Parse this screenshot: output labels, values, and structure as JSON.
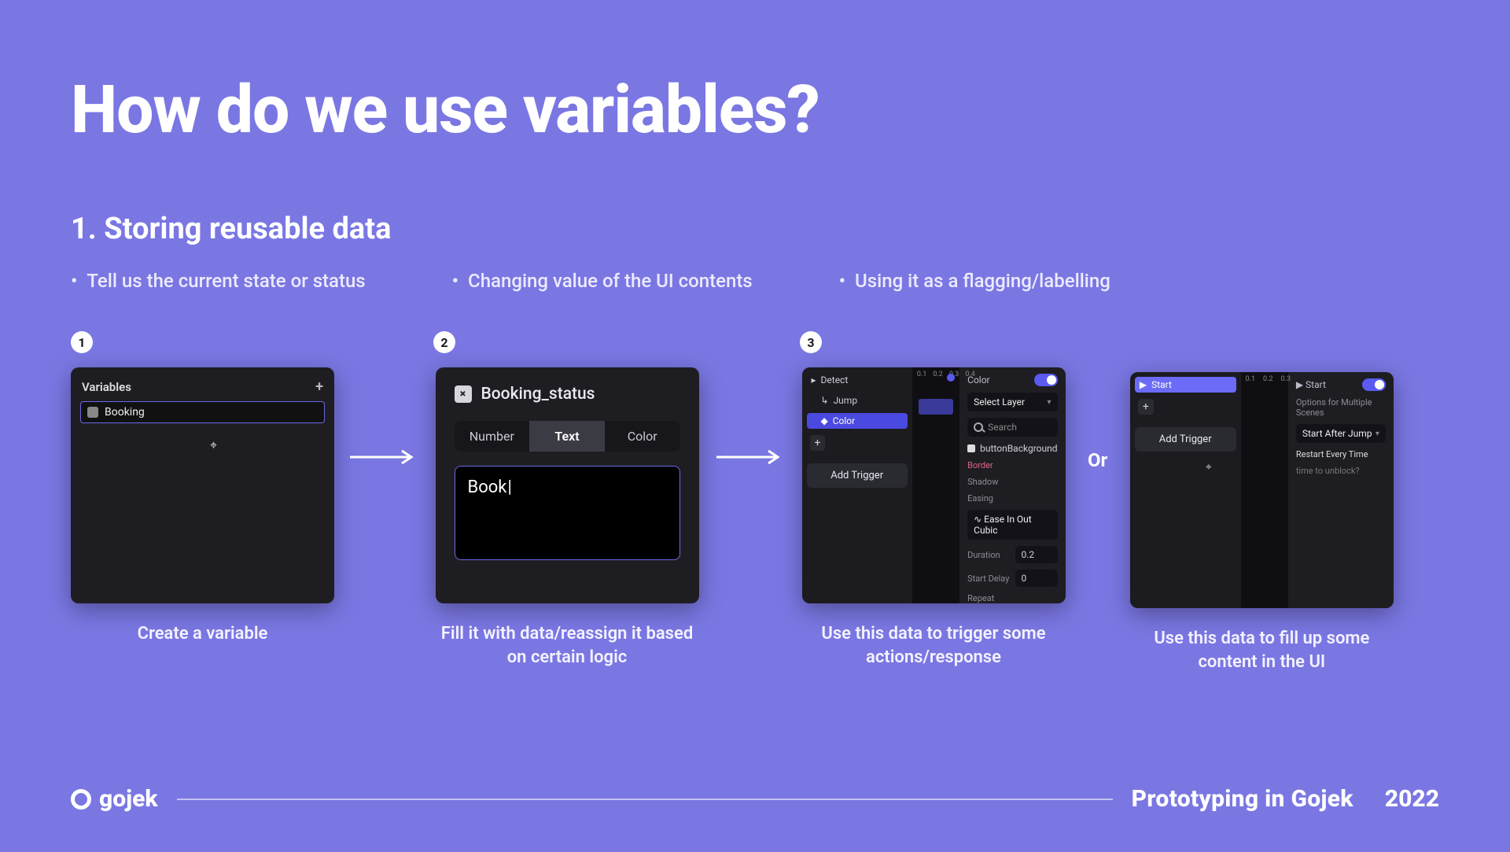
{
  "title": "How do we use variables?",
  "subtitle": "1.  Storing reusable data",
  "bullets": [
    "Tell us the current state or status",
    "Changing value of the UI contents",
    "Using it as a flagging/labelling"
  ],
  "badges": [
    "1",
    "2",
    "3"
  ],
  "captions": {
    "c1": "Create a variable",
    "c2": "Fill it with data/reassign it based on certain logic",
    "c3": "Use this data to trigger some actions/response",
    "c4": "Use this data to fill up some content in the UI"
  },
  "or_label": "Or",
  "panel1": {
    "header": "Variables",
    "plus": "+",
    "variable_name": "Booking"
  },
  "panel2": {
    "close_glyph": "×",
    "name": "Booking_status",
    "tabs": {
      "number": "Number",
      "text": "Text",
      "color": "Color"
    },
    "value": "Book"
  },
  "panel3": {
    "triggers": {
      "detect": "Detect",
      "jump": "Jump",
      "color": "Color"
    },
    "add_trigger": "Add Trigger",
    "timeline_markers": [
      "0.1",
      "0.2",
      "0.3",
      "0.4"
    ],
    "right": {
      "color_label": "Color",
      "select_layer": "Select Layer",
      "search_placeholder": "Search",
      "item": "buttonBackground",
      "border": "Border",
      "shadow": "Shadow",
      "easing_label": "Easing",
      "easing_value": "Ease In Out Cubic",
      "duration_label": "Duration",
      "duration_value": "0.2",
      "delay_label": "Start Delay",
      "delay_value": "0",
      "repeat_label": "Repeat"
    }
  },
  "panel4": {
    "start_label": "Start",
    "add_trigger": "Add Trigger",
    "timeline_markers": [
      "0.1",
      "0.2",
      "0.3"
    ],
    "right": {
      "start_label": "Start",
      "options_title": "Options for Multiple Scenes",
      "start_after": "Start After Jump",
      "restart": "Restart Every Time",
      "hint": "time to unblock?"
    }
  },
  "footer": {
    "brand": "gojek",
    "tagline": "Prototyping in Gojek",
    "year": "2022"
  }
}
